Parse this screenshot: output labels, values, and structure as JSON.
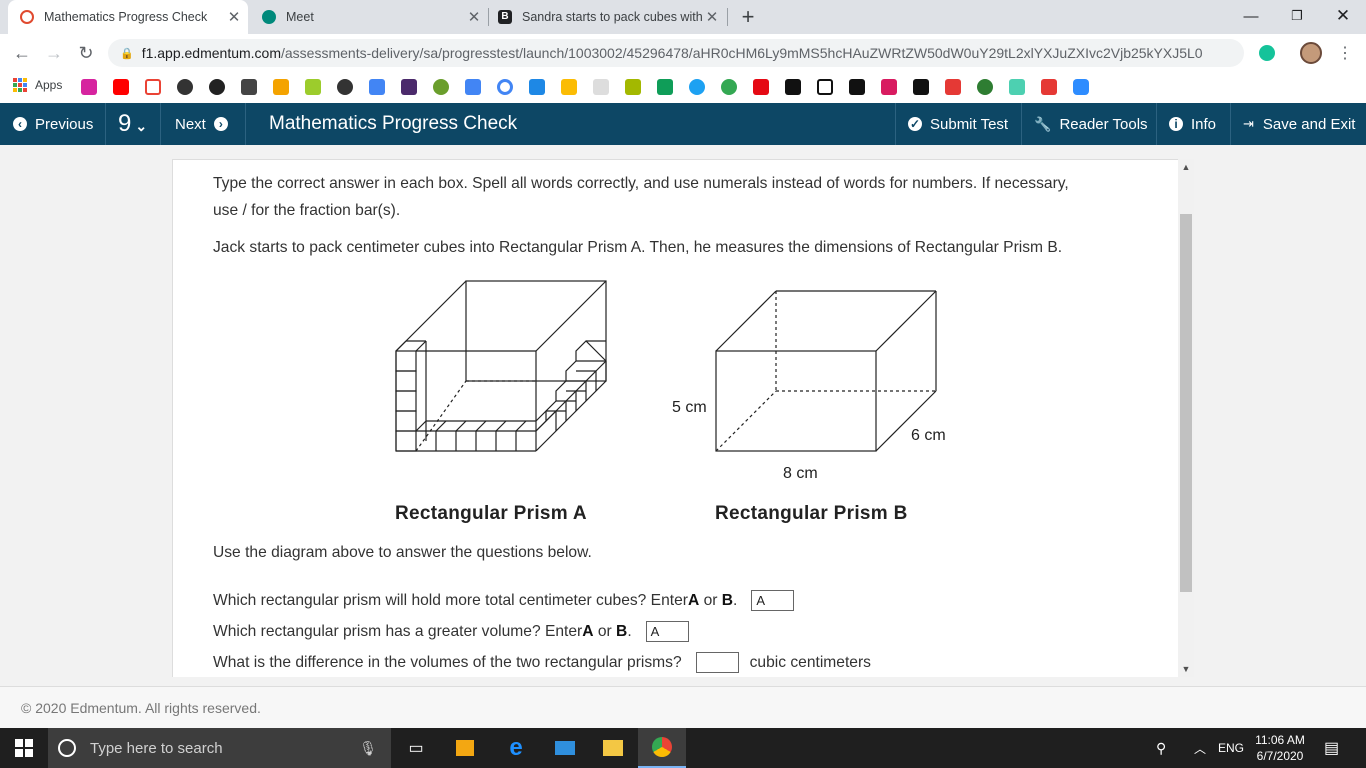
{
  "browser": {
    "tabs": [
      {
        "title": "Mathematics Progress Check",
        "favicon": "edmentum-icon",
        "active": true
      },
      {
        "title": "Meet",
        "favicon": "meet-icon",
        "active": false
      },
      {
        "title": "Sandra starts to pack cubes with",
        "favicon": "brainly-icon",
        "active": false
      }
    ],
    "new_tab": "+",
    "url_domain": "f1.app.edmentum.com",
    "url_path": "/assessments-delivery/sa/progresstest/launch/1003002/45296478/aHR0cHM6Ly9mMS5hcHAuZWRtZW50dW0uY29tL2xlYXJuZXIvc2Vjb25kYXJ5L0lu...",
    "bookmarks_apps_label": "Apps"
  },
  "appbar": {
    "previous": "Previous",
    "question_number": "9",
    "next": "Next",
    "title": "Mathematics Progress Check",
    "submit": "Submit Test",
    "reader_tools": "Reader Tools",
    "info": "Info",
    "save_exit": "Save and Exit"
  },
  "question": {
    "instructions_line1": "Type the correct answer in each box. Spell all words correctly, and use numerals instead of words for numbers. If necessary,",
    "instructions_line2": "use / for the fraction bar(s).",
    "prompt": "Jack starts to pack centimeter cubes into Rectangular Prism A. Then, he measures the dimensions of Rectangular Prism B.",
    "figure": {
      "prism_a_label": "Rectangular Prism A",
      "prism_b_label": "Rectangular Prism B",
      "dim_height": "5 cm",
      "dim_depth": "6 cm",
      "dim_width": "8 cm"
    },
    "use_diagram": "Use the diagram above to answer the questions below.",
    "q1_text_a": "Which rectangular prism will hold more total centimeter cubes? Enter ",
    "q1_bold_a": "A",
    "q1_or": " or ",
    "q1_bold_b": "B",
    "q1_end": ".",
    "q1_answer": "A",
    "q2_text_a": "Which rectangular prism has a greater volume? Enter ",
    "q2_bold_a": "A",
    "q2_or": " or ",
    "q2_bold_b": "B",
    "q2_end": ".",
    "q2_answer": "A",
    "q3_text": "What is the difference in the volumes of the two rectangular prisms?",
    "q3_answer": "",
    "q3_unit": "cubic centimeters"
  },
  "footer": "© 2020 Edmentum. All rights reserved.",
  "taskbar": {
    "search_placeholder": "Type here to search",
    "language": "ENG",
    "time": "11:06 AM",
    "date": "6/7/2020"
  }
}
